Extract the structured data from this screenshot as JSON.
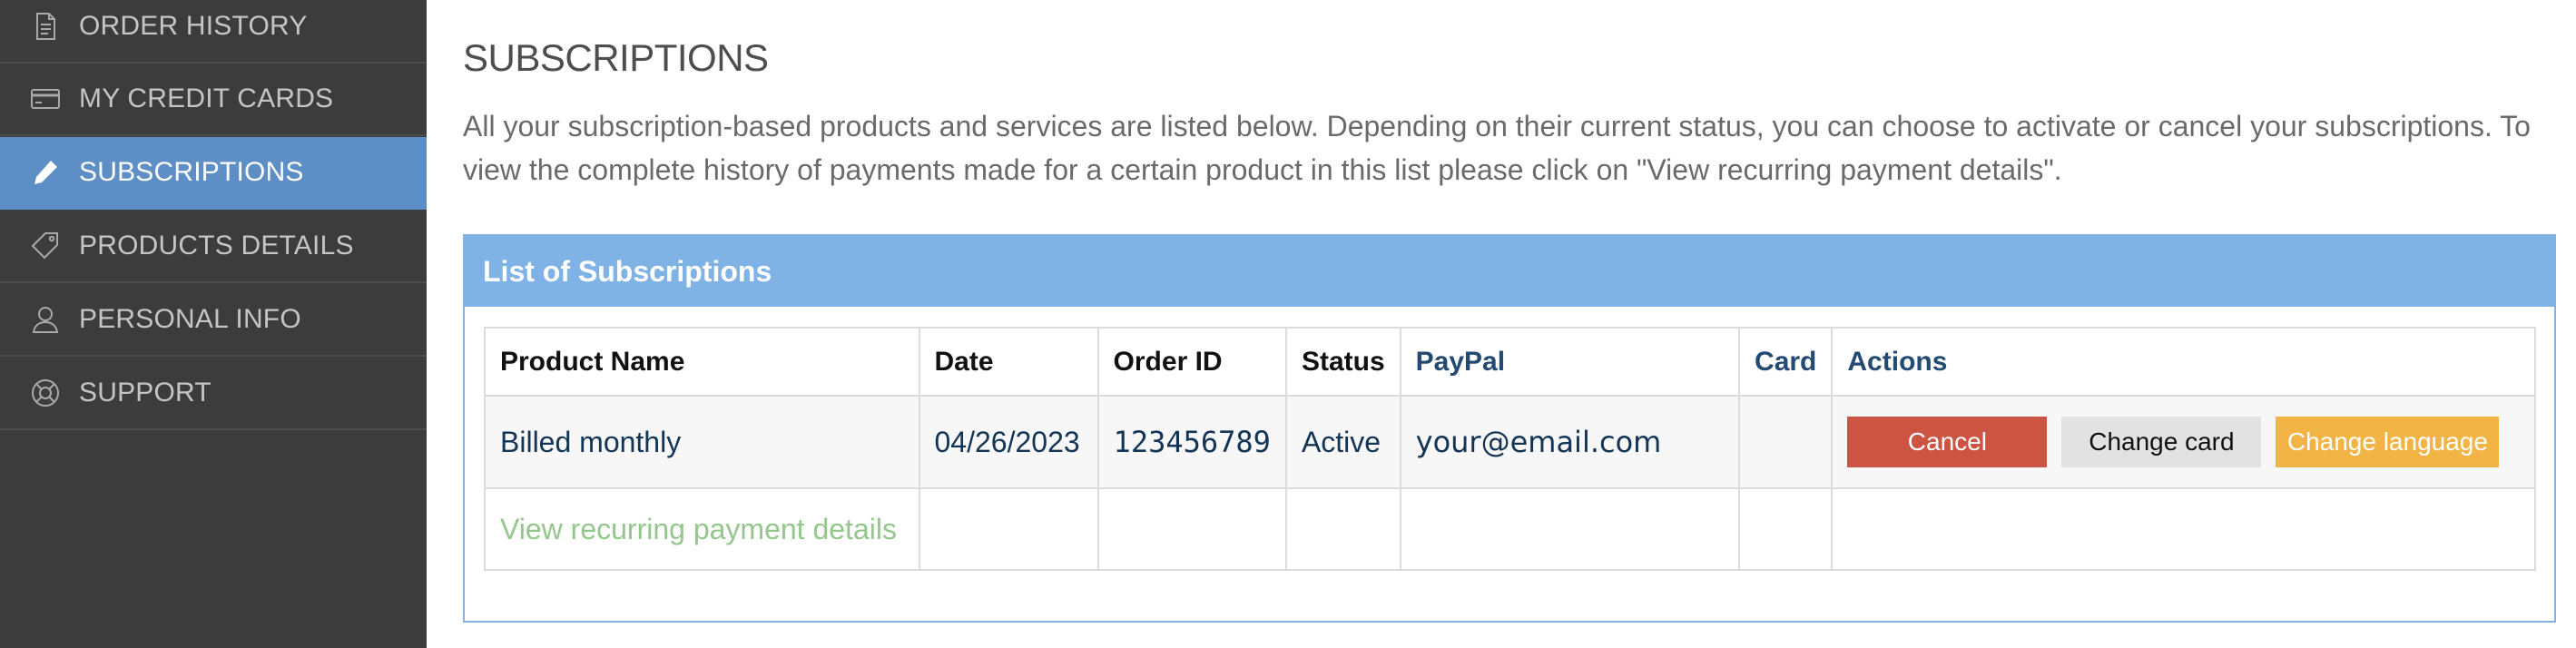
{
  "sidebar": {
    "items": [
      {
        "label": "ORDER HISTORY",
        "icon": "document-icon",
        "active": false
      },
      {
        "label": "MY CREDIT CARDS",
        "icon": "credit-card-icon",
        "active": false
      },
      {
        "label": "SUBSCRIPTIONS",
        "icon": "pencil-icon",
        "active": true
      },
      {
        "label": "PRODUCTS DETAILS",
        "icon": "tag-icon",
        "active": false
      },
      {
        "label": "PERSONAL INFO",
        "icon": "user-icon",
        "active": false
      },
      {
        "label": "SUPPORT",
        "icon": "lifebuoy-icon",
        "active": false
      }
    ]
  },
  "main": {
    "title": "SUBSCRIPTIONS",
    "description": "All your subscription-based products and services are listed below. Depending on their current status, you can choose to activate or cancel your subscriptions. To view the complete history of payments made for a certain product in this list please click on \"View recurring payment details\"."
  },
  "panel": {
    "title": "List of Subscriptions",
    "columns": [
      "Product Name",
      "Date",
      "Order ID",
      "Status",
      "PayPal",
      "Card",
      "Actions"
    ],
    "row": {
      "product_name": "Billed monthly",
      "date": "04/26/2023",
      "order_id": "123456789",
      "status": "Active",
      "paypal": "your@email.com",
      "card": ""
    },
    "actions": {
      "cancel": "Cancel",
      "change_card": "Change card",
      "change_language": "Change language"
    },
    "details_link": "View recurring payment details"
  },
  "colors": {
    "sidebar_bg": "#3c3c3c",
    "active_item": "#5d8fc6",
    "panel_header": "#7fb2e5",
    "cancel_button": "#cd5343",
    "change_card_button": "#e2e2e2",
    "change_language_button": "#f3b446",
    "details_link": "#93c78b"
  }
}
